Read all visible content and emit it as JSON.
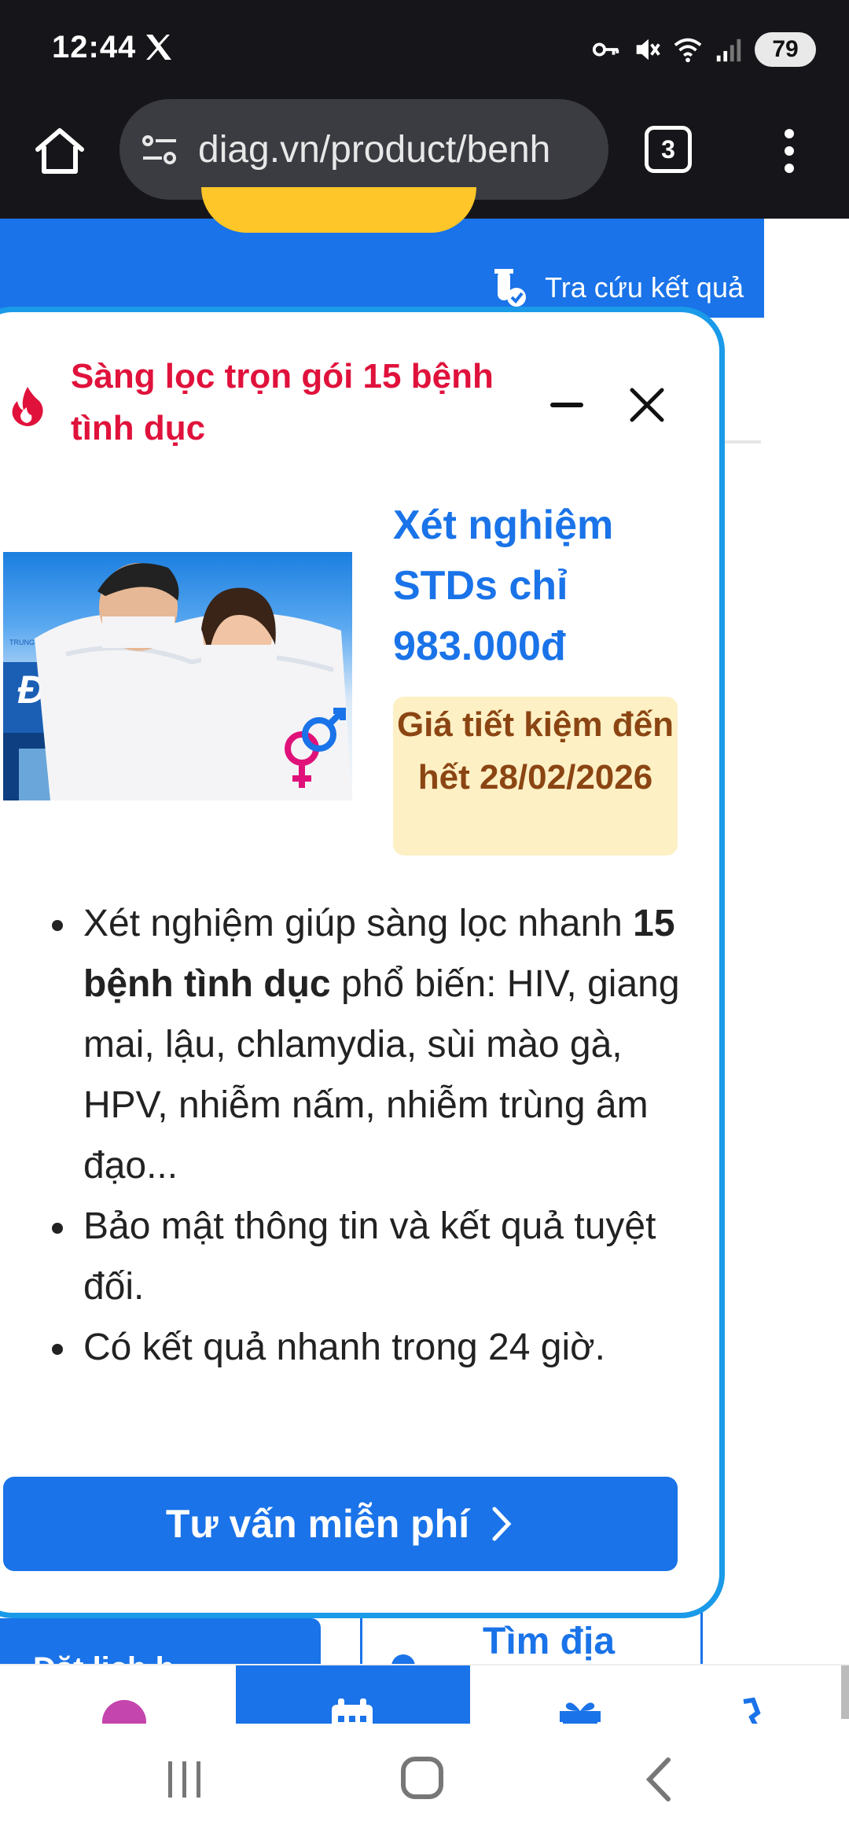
{
  "status_bar": {
    "time": "12:44",
    "battery": "79",
    "icons": [
      "x-logo-icon",
      "key-icon",
      "mute-icon",
      "wifi-icon",
      "signal-icon"
    ]
  },
  "browser": {
    "url": "diag.vn/product/benh",
    "tab_count": "3",
    "icons": [
      "home-icon",
      "site-settings-icon",
      "menu-icon"
    ]
  },
  "page": {
    "lookup_label": "Tra cứu kết quả",
    "book_button_label": "Đặt lịch h",
    "find_label": "Tìm địa"
  },
  "popup": {
    "title": "Sàng lọc trọn gói 15 bệnh tình dục",
    "promo_title": "Xét nghiệm STDs chỉ 983.000đ",
    "badge": "Giá tiết kiệm đến hết 28/02/2026",
    "bullets": [
      {
        "before": "Xét nghiệm giúp sàng lọc nhanh ",
        "bold": "15 bệnh tình dục",
        "after": " phổ biến: HIV, giang mai, lậu, chlamydia, sùi mào gà, HPV, nhiễm nấm, nhiễm trùng âm đạo..."
      },
      {
        "before": "Bảo mật thông tin và kết quả tuyệt đối.",
        "bold": "",
        "after": ""
      },
      {
        "before": "Có kết quả nhanh trong 24 giờ.",
        "bold": "",
        "after": ""
      }
    ],
    "cta_label": "Tư vấn miễn phí",
    "image": {
      "logo_text": "Điag",
      "sign_small_text": "TRUNG TÂM Y KHOA"
    }
  },
  "colors": {
    "primary_blue": "#1a73e8",
    "popup_border": "#1a9ae8",
    "title_red": "#e0123c",
    "badge_bg": "#fdf0c4",
    "badge_text": "#8b4513"
  }
}
